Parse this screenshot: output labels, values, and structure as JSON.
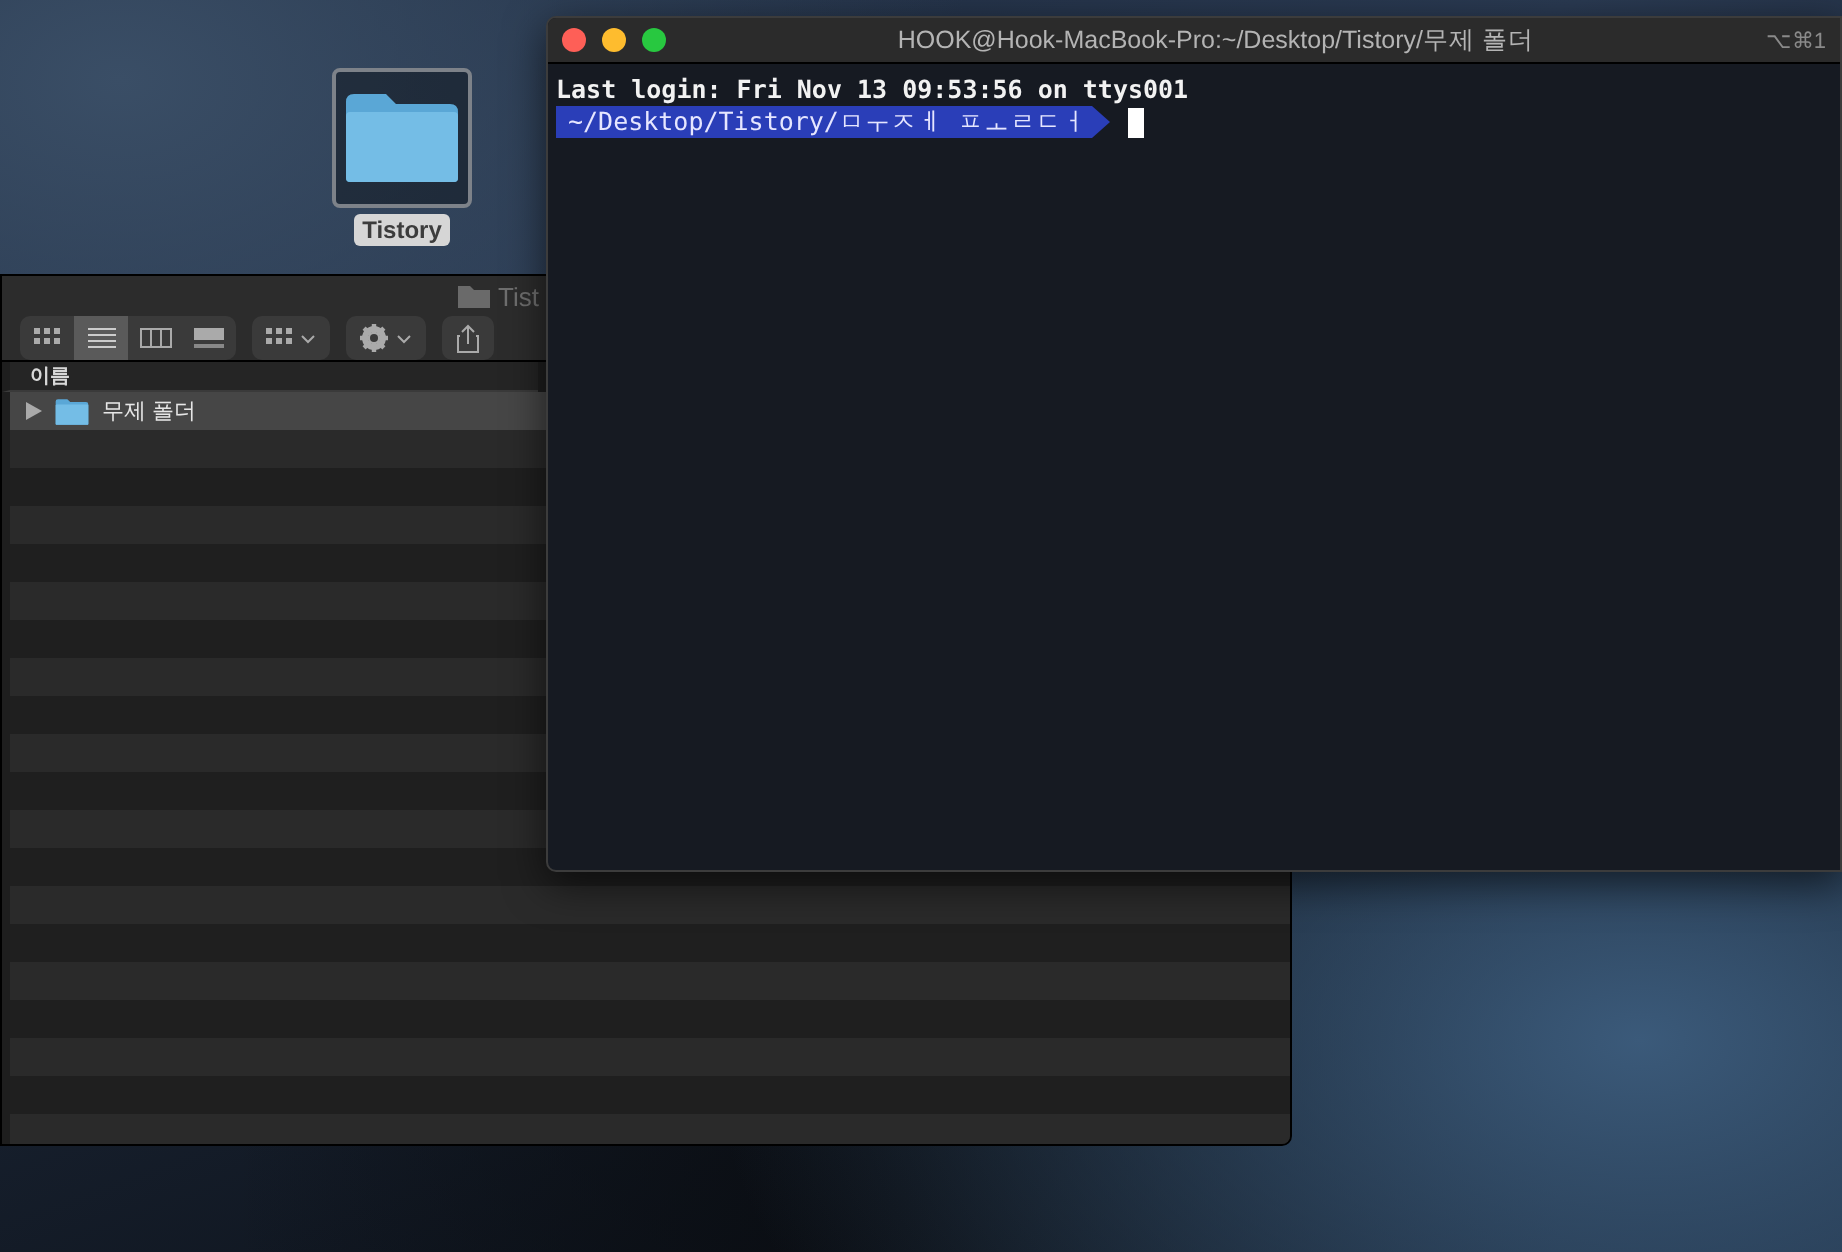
{
  "desktop_icon": {
    "label": "Tistory",
    "selected": true
  },
  "finder": {
    "title": "Tist",
    "view_buttons": [
      {
        "kind": "icons",
        "selected": false
      },
      {
        "kind": "list",
        "selected": true
      },
      {
        "kind": "columns",
        "selected": false
      },
      {
        "kind": "gallery",
        "selected": false
      }
    ],
    "column_header": "이름",
    "rows": [
      {
        "name": "무제 폴더",
        "expanded": false,
        "selected": true
      }
    ]
  },
  "terminal": {
    "title": "HOOK@Hook-MacBook-Pro:~/Desktop/Tistory/무제 폴더",
    "shortcut": "⌥⌘1",
    "login_line": "Last login: Fri Nov 13 09:53:56 on ttys001",
    "prompt": "~/Desktop/Tistory/ㅁㅜㅈㅔ ㅍㅗㄹㄷㅓ"
  }
}
